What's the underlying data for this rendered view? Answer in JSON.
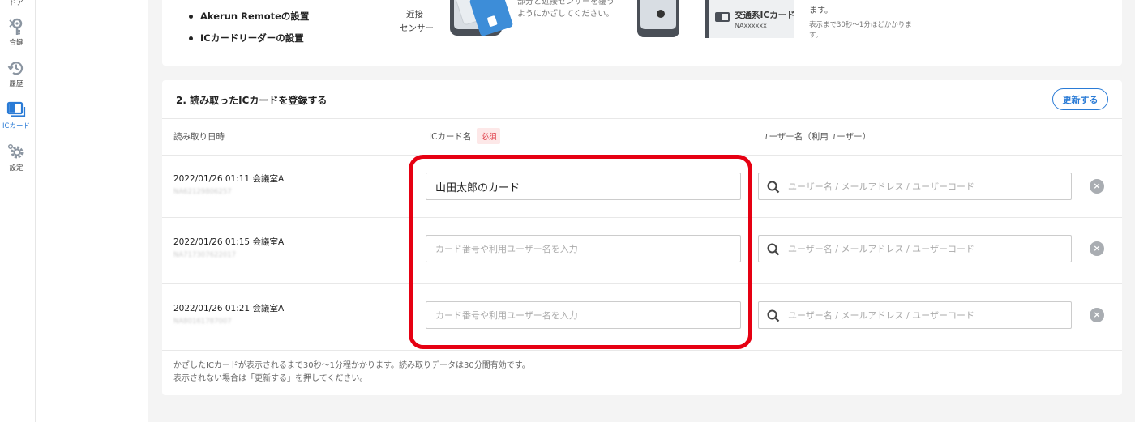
{
  "nav": {
    "top_label": "ドア",
    "items": [
      {
        "label": "合鍵",
        "icon": "key-icon"
      },
      {
        "label": "履歴",
        "icon": "history-icon"
      },
      {
        "label": "ICカード",
        "icon": "ic-card-icon",
        "active": true
      },
      {
        "label": "設定",
        "icon": "gear-icon"
      }
    ]
  },
  "top_card": {
    "bullets": [
      "Akerun Remoteの設置",
      "ICカードリーダーの設置"
    ],
    "sensor_label_line1": "近接",
    "sensor_label_line2": "センサー",
    "description": "部分と近接センサーを覆うようにかざしてください。",
    "transit_title": "交通系ICカード",
    "transit_id": "NAxxxxxx",
    "note_main": "ます。",
    "note_sub": "表示まで30秒〜1分ほどかかります。"
  },
  "section": {
    "title": "2. 読み取ったICカードを登録する",
    "refresh_label": "更新する",
    "columns": {
      "read_time": "読み取り日時",
      "card_name": "ICカード名",
      "required": "必須",
      "user_name": "ユーザー名（利用ユーザー）"
    },
    "card_placeholder": "カード番号や利用ユーザー名を入力",
    "user_placeholder": "ユーザー名 / メールアドレス / ユーザーコード",
    "rows": [
      {
        "datetime": "2022/01/26 01:11 会議室A",
        "card_id": "NA62129806257",
        "card_name": "山田太郎のカード"
      },
      {
        "datetime": "2022/01/26 01:15 会議室A",
        "card_id": "NA717307622017",
        "card_name": ""
      },
      {
        "datetime": "2022/01/26 01:21 会議室A",
        "card_id": "NA80161787007",
        "card_name": ""
      }
    ],
    "footer_line1": "かざしたICカードが表示されるまで30秒〜1分程かかります。読み取りデータは30分間有効です。",
    "footer_line2": "表示されない場合は「更新する」を押してください。"
  },
  "colors": {
    "accent": "#2a7bd6",
    "highlight": "#e60012",
    "required_text": "#e0414b"
  }
}
